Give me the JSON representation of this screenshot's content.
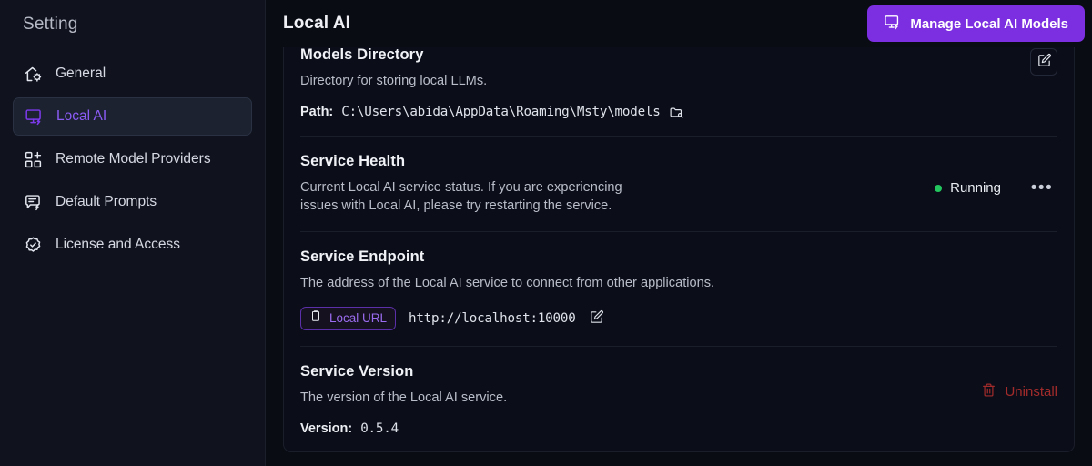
{
  "sidebar": {
    "title": "Setting",
    "items": [
      {
        "label": "General",
        "icon": "house-gear-icon",
        "active": false
      },
      {
        "label": "Local AI",
        "icon": "monitor-bolt-icon",
        "active": true
      },
      {
        "label": "Remote Model Providers",
        "icon": "grid-plus-icon",
        "active": false
      },
      {
        "label": "Default Prompts",
        "icon": "message-bolt-icon",
        "active": false
      },
      {
        "label": "License and Access",
        "icon": "badge-check-icon",
        "active": false
      }
    ]
  },
  "header": {
    "title": "Local AI",
    "manage_button": {
      "label": "Manage Local AI Models",
      "icon": "monitor-bolt-icon"
    }
  },
  "sections": {
    "models_directory": {
      "title": "Models Directory",
      "description": "Directory for storing local LLMs.",
      "path_label": "Path:",
      "path_value": "C:\\Users\\abida\\AppData\\Roaming\\Msty\\models",
      "path_icon": "folder-search-icon",
      "edit_icon": "edit-square-icon"
    },
    "service_health": {
      "title": "Service Health",
      "description": "Current Local AI service status. If you are experiencing issues with Local AI, please try restarting the service.",
      "status_text": "Running",
      "status_color": "#22c55e",
      "menu_label": "•••",
      "menu_icon": "ellipsis-icon"
    },
    "service_endpoint": {
      "title": "Service Endpoint",
      "description": "The address of the Local AI service to connect from other applications.",
      "badge_label": "Local URL",
      "badge_icon": "clipboard-icon",
      "url_value": "http://localhost:10000",
      "edit_icon": "edit-square-icon"
    },
    "service_version": {
      "title": "Service Version",
      "description": "The version of the Local AI service.",
      "version_label": "Version:",
      "version_value": "0.5.4",
      "uninstall_label": "Uninstall",
      "uninstall_icon": "trash-icon",
      "uninstall_color": "#a32b2b"
    }
  },
  "theme": {
    "accent": "#7c2fe0",
    "background": "#0a0c14",
    "sidebar_background": "#10131e"
  }
}
